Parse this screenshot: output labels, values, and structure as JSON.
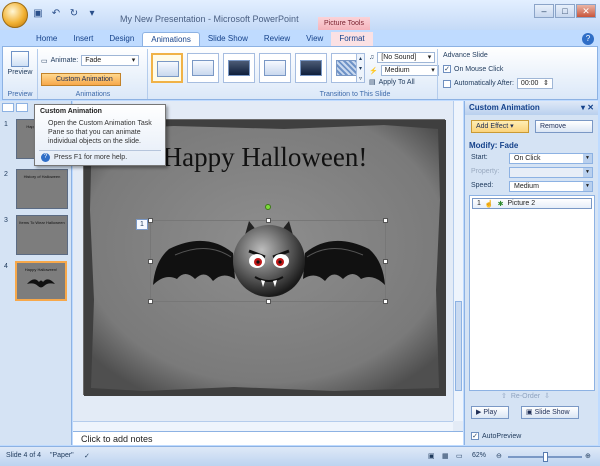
{
  "window": {
    "title": "My New Presentation - Microsoft PowerPoint",
    "context_tab_group": "Picture Tools",
    "controls": [
      "–",
      "□",
      "✕"
    ]
  },
  "tabs": [
    "Home",
    "Insert",
    "Design",
    "Animations",
    "Slide Show",
    "Review",
    "View",
    "Format"
  ],
  "active_tab": "Animations",
  "ribbon": {
    "preview_label": "Preview",
    "preview_group": "Preview",
    "animate_label": "Animate:",
    "animate_value": "Fade",
    "custom_animation_label": "Custom Animation",
    "animations_group": "Animations",
    "transition_group": "Transition to This Slide",
    "sound_value": "[No Sound]",
    "speed_value": "Medium",
    "apply_to_all_label": "Apply To All",
    "advance_slide_label": "Advance Slide",
    "on_mouse_click_label": "On Mouse Click",
    "on_mouse_click_checked": true,
    "auto_after_label": "Automatically After:",
    "auto_after_value": "00:00"
  },
  "tooltip": {
    "title": "Custom Animation",
    "body": "Open the Custom Animation Task Pane so that you can animate individual objects on the slide.",
    "help": "Press F1 for more help."
  },
  "slides": [
    {
      "num": "1",
      "caption": "Happy Halloween"
    },
    {
      "num": "2",
      "caption": "History of Halloween"
    },
    {
      "num": "3",
      "caption": "Items To Wear Halloween"
    },
    {
      "num": "4",
      "caption": "Happy Halloween!",
      "selected": true
    }
  ],
  "slide": {
    "title": "Happy Halloween!",
    "animation_tag": "1"
  },
  "notes_placeholder": "Click to add notes",
  "task_pane": {
    "title": "Custom Animation",
    "add_effect": "Add Effect",
    "remove": "Remove",
    "modify": "Modify: Fade",
    "start_label": "Start:",
    "start_value": "On Click",
    "property_label": "Property:",
    "property_value": "",
    "speed_label": "Speed:",
    "speed_value": "Medium",
    "item_index": "1",
    "item_name": "Picture 2",
    "reorder_label": "Re-Order",
    "play": "Play",
    "slide_show": "Slide Show",
    "autopreview": "AutoPreview",
    "autopreview_checked": true
  },
  "status": {
    "slide_of": "Slide 4 of 4",
    "theme": "\"Paper\"",
    "zoom": "62%"
  }
}
